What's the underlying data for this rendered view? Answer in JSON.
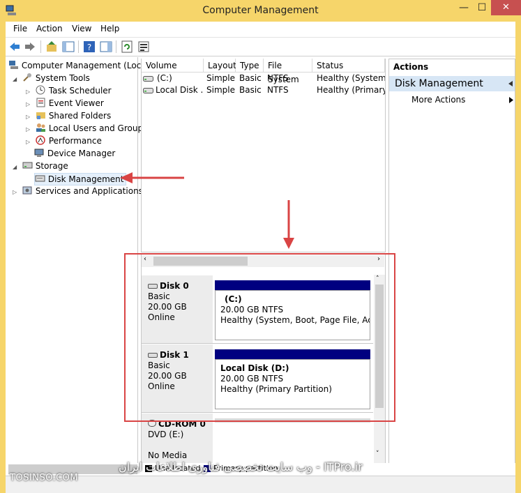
{
  "window": {
    "title": "Computer Management",
    "minimize": "—",
    "maximize": "☐",
    "close": "✕"
  },
  "menu": [
    "File",
    "Action",
    "View",
    "Help"
  ],
  "tree": {
    "root": "Computer Management (Local",
    "system_tools": "System Tools",
    "task_scheduler": "Task Scheduler",
    "event_viewer": "Event Viewer",
    "shared_folders": "Shared Folders",
    "local_users": "Local Users and Groups",
    "performance": "Performance",
    "device_manager": "Device Manager",
    "storage": "Storage",
    "disk_management": "Disk Management",
    "services": "Services and Applications"
  },
  "volumes": {
    "columns": [
      "Volume",
      "Layout",
      "Type",
      "File System",
      "Status"
    ],
    "rows": [
      [
        "(C:)",
        "Simple",
        "Basic",
        "NTFS",
        "Healthy (System, B"
      ],
      [
        "Local Disk ...",
        "Simple",
        "Basic",
        "NTFS",
        "Healthy (Primary P"
      ]
    ]
  },
  "actions": {
    "header": "Actions",
    "section": "Disk Management",
    "more": "More Actions"
  },
  "disks": [
    {
      "name": "Disk 0",
      "type": "Basic",
      "size": "20.00 GB",
      "status": "Online",
      "partition_name": "(C:)",
      "partition_size": "20.00 GB NTFS",
      "partition_status": "Healthy (System, Boot, Page File, Active,"
    },
    {
      "name": "Disk 1",
      "type": "Basic",
      "size": "20.00 GB",
      "status": "Online",
      "partition_name": "Local Disk  (D:)",
      "partition_size": "20.00 GB NTFS",
      "partition_status": "Healthy (Primary Partition)"
    }
  ],
  "cdrom": {
    "name": "CD-ROM 0",
    "drive": "DVD (E:)",
    "media": "No Media"
  },
  "legend": {
    "unallocated": "Unallocated",
    "primary": "Primary partition"
  },
  "watermarks": {
    "left": "TOSINSO.COM",
    "right": "وب سایت تخصصی فناوری اطلاعات ایران - ITPro.ir"
  },
  "colors": {
    "titlebar": "#f6d56a",
    "partition_bar": "#000080",
    "highlight": "#d94444",
    "selection": "#d7e6f5"
  }
}
